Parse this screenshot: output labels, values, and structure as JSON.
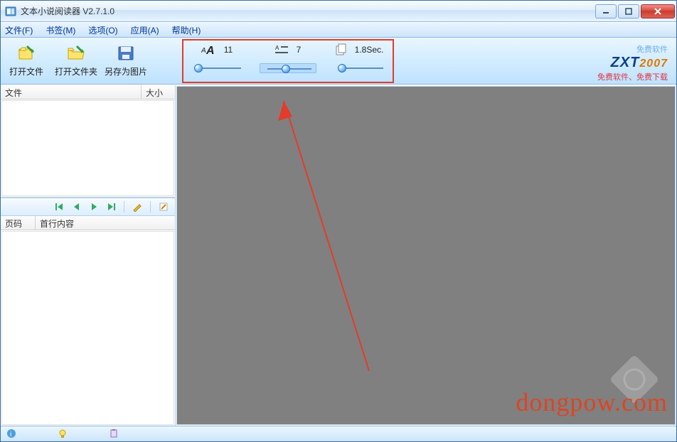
{
  "window": {
    "title": "文本小说阅读器 V2.7.1.0"
  },
  "menu": {
    "file": "文件(F)",
    "bookmark": "书签(M)",
    "options": "选项(O)",
    "apps": "应用(A)",
    "help": "帮助(H)"
  },
  "toolbar": {
    "open_file": "打开文件",
    "open_folder": "打开文件夹",
    "save_as_image": "另存为图片"
  },
  "sliders": {
    "font_size": "11",
    "line_spacing": "7",
    "interval": "1.8Sec."
  },
  "logo": {
    "free": "免费软件",
    "brand": "ZXT",
    "year": "2007",
    "sub": "免费软件、免费下载"
  },
  "panels": {
    "top": {
      "col_file": "文件",
      "col_size": "大小"
    },
    "bottom": {
      "col_page": "页码",
      "col_firstline": "首行内容"
    }
  },
  "watermark": "dongpow.com",
  "colors": {
    "accent": "#3a8fe0",
    "highlight": "#e23c2a"
  }
}
